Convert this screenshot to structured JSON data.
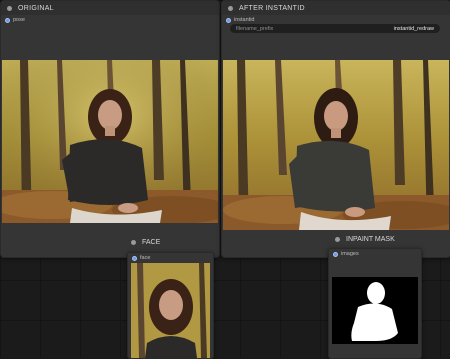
{
  "nodes": {
    "original": {
      "title": "ORIGINAL",
      "input_label": "pose"
    },
    "after": {
      "title": "AFTER INSTANTID",
      "input_label": "instantid",
      "filename_label": "filename_prefix",
      "filename_value": "instantid_redraw"
    },
    "face": {
      "title": "FACE",
      "input_label": "face"
    },
    "mask": {
      "title": "INPAINT MASK",
      "input_label": "images"
    }
  },
  "colors": {
    "node_bg": "#353535",
    "port": "#6a9be8",
    "canvas": "#1b1b1b"
  }
}
